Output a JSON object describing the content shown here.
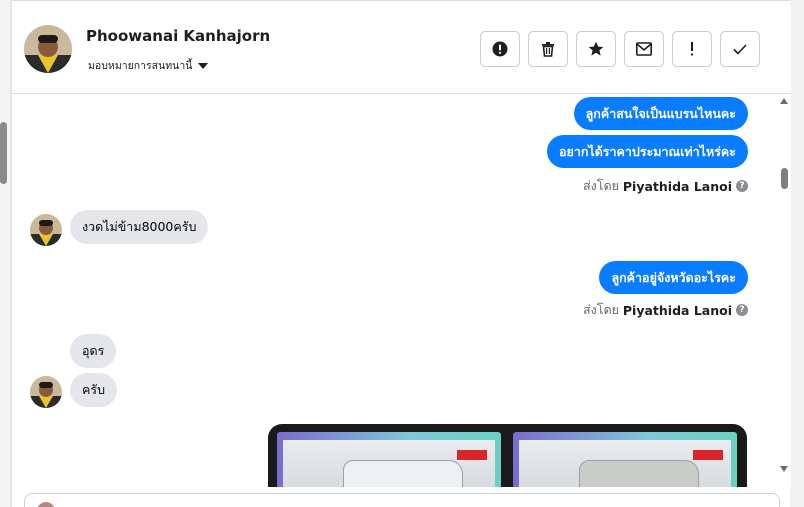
{
  "conversation": {
    "contact_name": "Phoowanai Kanhajorn",
    "assign_label": "มอบหมายการสนทนานี้",
    "actions": [
      {
        "name": "spam-button",
        "icon": "alert-circle-icon"
      },
      {
        "name": "delete-button",
        "icon": "trash-icon"
      },
      {
        "name": "follow-up-button",
        "icon": "star-icon"
      },
      {
        "name": "mark-unread-button",
        "icon": "envelope-icon"
      },
      {
        "name": "mark-important-button",
        "icon": "exclamation-icon"
      },
      {
        "name": "mark-done-button",
        "icon": "check-icon"
      }
    ]
  },
  "messages": {
    "out1": "ลูกค้าสนใจเป็นแบรนไหนคะ",
    "out2": "อยากได้ราคาประมาณเท่าไหร่คะ",
    "sent_by_prefix": "ส่งโดย",
    "sent_by_name": "Piyathida Lanoi",
    "in1": "งวดไม่ข้าม8000ครับ",
    "out3": "ลูกค้าอยู่จังหวัดอะไรคะ",
    "sent_by_prefix_2": "ส่งโดย",
    "sent_by_name_2": "Piyathida Lanoi",
    "in2": "อุดร",
    "in3": "ครับ"
  },
  "colors": {
    "outgoing_bubble": "#0a7cff",
    "incoming_bubble": "#e4e6eb"
  }
}
